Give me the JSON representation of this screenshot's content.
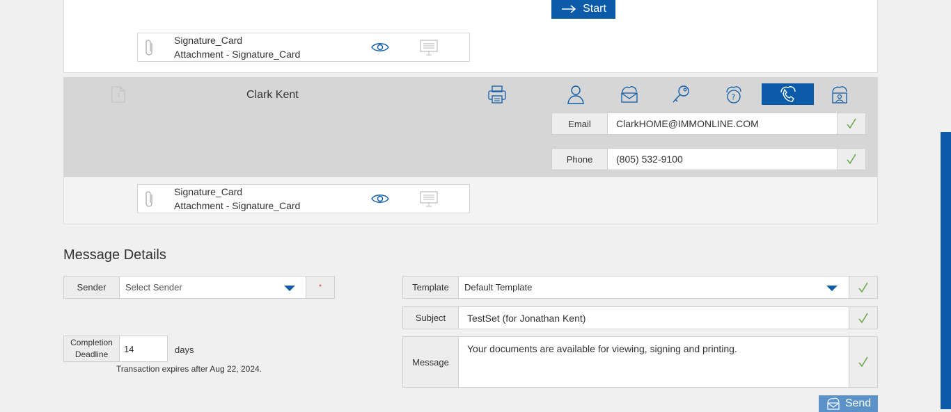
{
  "top": {
    "start_label": "Start",
    "attachment": {
      "name": "Signature_Card",
      "subtitle": "Attachment - Signature_Card"
    }
  },
  "signer": {
    "name": "Clark Kent",
    "methods": [
      {
        "icon": "person-icon",
        "active": false
      },
      {
        "icon": "envelope-cloud-icon",
        "active": false
      },
      {
        "icon": "key-icon",
        "active": false
      },
      {
        "icon": "question-shield-icon",
        "active": false
      },
      {
        "icon": "phone-icon",
        "active": true
      },
      {
        "icon": "person-cloud-icon",
        "active": false
      }
    ],
    "email_label": "Email",
    "email_value": "ClarkHOME@IMMONLINE.COM",
    "phone_label": "Phone",
    "phone_value": "(805) 532-9100",
    "attachment": {
      "name": "Signature_Card",
      "subtitle": "Attachment - Signature_Card"
    }
  },
  "message_details": {
    "title": "Message Details",
    "sender_label": "Sender",
    "sender_placeholder": "Select Sender",
    "required_marker": "*",
    "completion_label_1": "Completion",
    "completion_label_2": "Deadline",
    "completion_value": "14",
    "days_label": "days",
    "expires_note": "Transaction expires after Aug 22, 2024.",
    "template_label": "Template",
    "template_value": "Default Template",
    "subject_label": "Subject",
    "subject_value": "TestSet (for Jonathan Kent)",
    "message_label": "Message",
    "message_value": "Your documents are available for viewing, signing and printing.",
    "send_label": "Send"
  },
  "colors": {
    "accent": "#0b5ba8",
    "check": "#6aa84f",
    "signer_bg": "#d6d6d6"
  }
}
